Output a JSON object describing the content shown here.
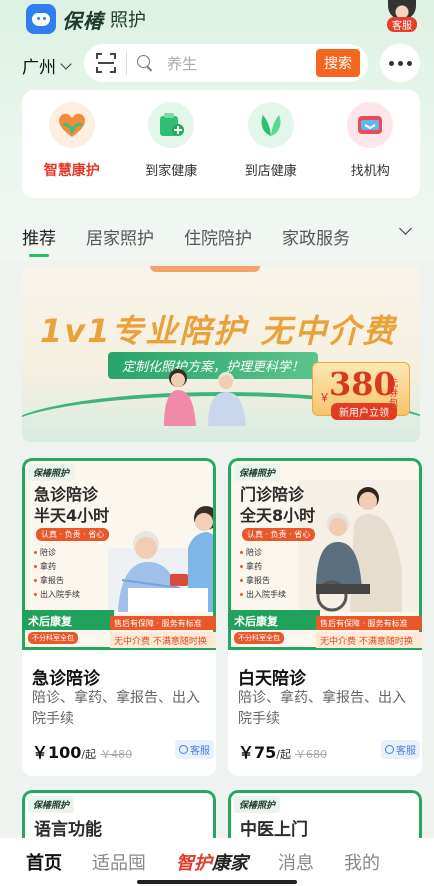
{
  "header": {
    "logo_text": "保椿",
    "logo_sub": "照护",
    "kefu_label": "客服"
  },
  "location": {
    "city": "广州"
  },
  "search": {
    "placeholder": "养生",
    "button": "搜索"
  },
  "services": [
    {
      "label": "智慧康护",
      "icon": "heart-hands-icon",
      "color": "#f58a3a"
    },
    {
      "label": "到家健康",
      "icon": "medical-kit-icon",
      "color": "#2fbf72"
    },
    {
      "label": "到店健康",
      "icon": "leaf-icon",
      "color": "#2fbf72"
    },
    {
      "label": "找机构",
      "icon": "card-icon",
      "color": "#e84b5a"
    }
  ],
  "tabs": [
    "推荐",
    "居家照护",
    "住院陪护",
    "家政服务"
  ],
  "banner": {
    "headline": "1v1专业陪护 无中介费",
    "subline": "定制化照护方案，护理更科学！",
    "coupon_amount": "380",
    "coupon_unit": "元券包",
    "coupon_currency": "￥",
    "coupon_button": "新用户立领"
  },
  "cards": [
    {
      "brand": "保椿照护",
      "poster_title": [
        "急诊陪诊",
        "半天4小时"
      ],
      "poster_tag": "认真 · 负责 · 省心",
      "poster_items": [
        "陪诊",
        "拿药",
        "拿报告",
        "出入院手续"
      ],
      "poster_green": "术后康复",
      "poster_small": "不分科室全包",
      "poster_orange": "售后有保障 · 服务有标准",
      "poster_orange2": "无中介费 不满意随时换",
      "title": "急诊陪诊",
      "desc": "陪诊、拿药、拿报告、出入院手续",
      "price": "￥100",
      "price_unit": "/起",
      "orig_price": "￥480",
      "kefu": "客服"
    },
    {
      "brand": "保椿照护",
      "poster_title": [
        "门诊陪诊",
        "全天8小时"
      ],
      "poster_tag": "认真 · 负责 · 省心",
      "poster_items": [
        "陪诊",
        "拿药",
        "拿报告",
        "出入院手续"
      ],
      "poster_green": "术后康复",
      "poster_small": "不分科室全包",
      "poster_orange": "售后有保障 · 服务有标准",
      "poster_orange2": "无中介费 不满意随时换",
      "title": "白天陪诊",
      "desc": "陪诊、拿药、拿报告、出入院手续",
      "price": "￥75",
      "price_unit": "/起",
      "orig_price": "￥680",
      "kefu": "客服"
    }
  ],
  "partial_cards": [
    {
      "brand": "保椿照护",
      "poster_title": "语言功能"
    },
    {
      "brand": "保椿照护",
      "poster_title": "中医上门"
    }
  ],
  "nav": {
    "home": "首页",
    "shop": "适品囤",
    "center_a": "智护",
    "center_b": "康家",
    "msg": "消息",
    "mine": "我的"
  }
}
